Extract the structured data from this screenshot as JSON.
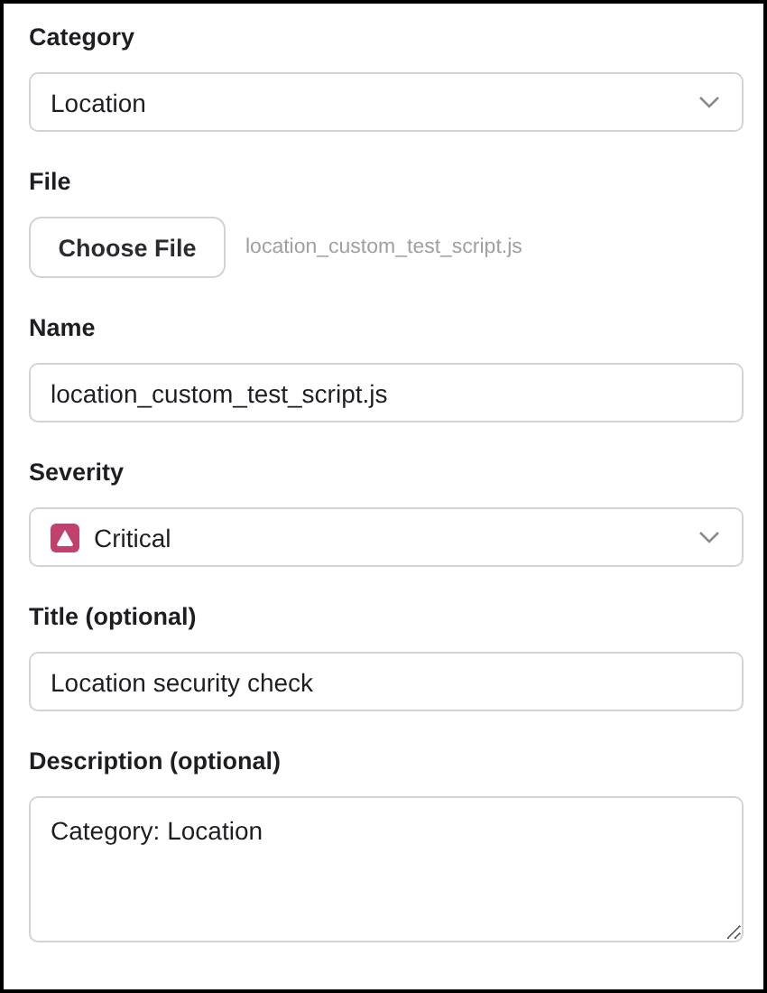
{
  "fields": [
    {
      "kind": "select",
      "label": "Category",
      "value": "Location"
    },
    {
      "kind": "file",
      "label": "File",
      "button": "Choose File",
      "file_name": "location_custom_test_script.js"
    },
    {
      "kind": "input",
      "label": "Name",
      "value": "location_custom_test_script.js"
    },
    {
      "kind": "select",
      "label": "Severity",
      "value": "Critical",
      "color": "#c0406e"
    },
    {
      "kind": "input",
      "label": "Title (optional)",
      "value": "Location security check"
    },
    {
      "kind": "textarea",
      "label": "Description (optional)",
      "value": "Category: Location"
    }
  ]
}
